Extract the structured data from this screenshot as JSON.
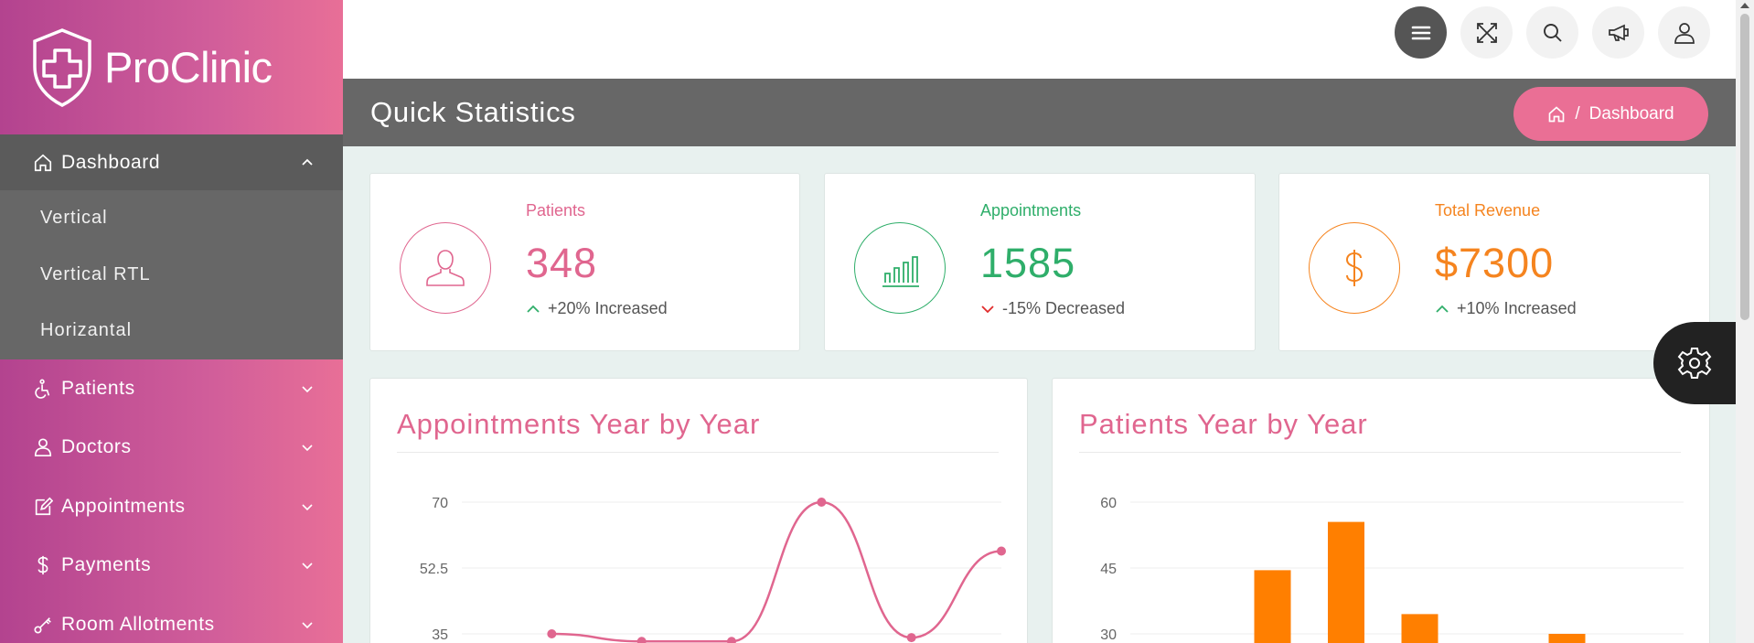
{
  "brand": {
    "name": "ProClinic"
  },
  "sidebar": {
    "dashboard": {
      "label": "Dashboard",
      "icon": "home-icon"
    },
    "dashboard_sub": [
      {
        "label": "Vertical"
      },
      {
        "label": "Vertical RTL"
      },
      {
        "label": "Horizantal"
      }
    ],
    "items": [
      {
        "label": "Patients",
        "icon": "wheelchair-icon"
      },
      {
        "label": "Doctors",
        "icon": "doctor-icon"
      },
      {
        "label": "Appointments",
        "icon": "edit-icon"
      },
      {
        "label": "Payments",
        "icon": "dollar-icon"
      },
      {
        "label": "Room Allotments",
        "icon": "key-icon"
      }
    ]
  },
  "topbar": {
    "buttons": [
      "menu-icon",
      "fullscreen-icon",
      "search-icon",
      "megaphone-icon",
      "user-icon"
    ]
  },
  "header": {
    "title": "Quick Statistics",
    "breadcrumb": {
      "separator": "/",
      "label": "Dashboard"
    }
  },
  "stats": [
    {
      "label": "Patients",
      "value": "348",
      "trend": "+20% Increased",
      "direction": "up",
      "color": "#e0668f",
      "icon": "user-icon"
    },
    {
      "label": "Appointments",
      "value": "1585",
      "trend": "-15% Decreased",
      "direction": "down",
      "color": "#2fae6a",
      "icon": "bar-chart-icon"
    },
    {
      "label": "Total Revenue",
      "value": "$7300",
      "trend": "+10% Increased",
      "direction": "up",
      "color": "#f5841f",
      "icon": "dollar-icon"
    }
  ],
  "colors": {
    "pink": "#e0668f",
    "green": "#2fae6a",
    "orange": "#ff7f00",
    "up_arrow": "#2fae6a",
    "down_arrow": "#e02b2b"
  },
  "chart_data": [
    {
      "type": "line",
      "title": "Appointments Year by Year",
      "y_ticks": [
        "70",
        "52.5",
        "35"
      ],
      "ylim_visible": [
        35,
        70
      ],
      "series": [
        {
          "values": [
            null,
            35,
            33,
            33,
            70,
            34,
            57
          ]
        }
      ],
      "color": "#e0668f",
      "grid": true
    },
    {
      "type": "bar",
      "title": "Patients Year by Year",
      "y_ticks": [
        "60",
        "45",
        "30"
      ],
      "ylim_visible": [
        30,
        60
      ],
      "values": [
        null,
        44.5,
        55.5,
        34.5,
        null,
        30
      ],
      "color": "#ff7f00",
      "grid": true
    }
  ]
}
